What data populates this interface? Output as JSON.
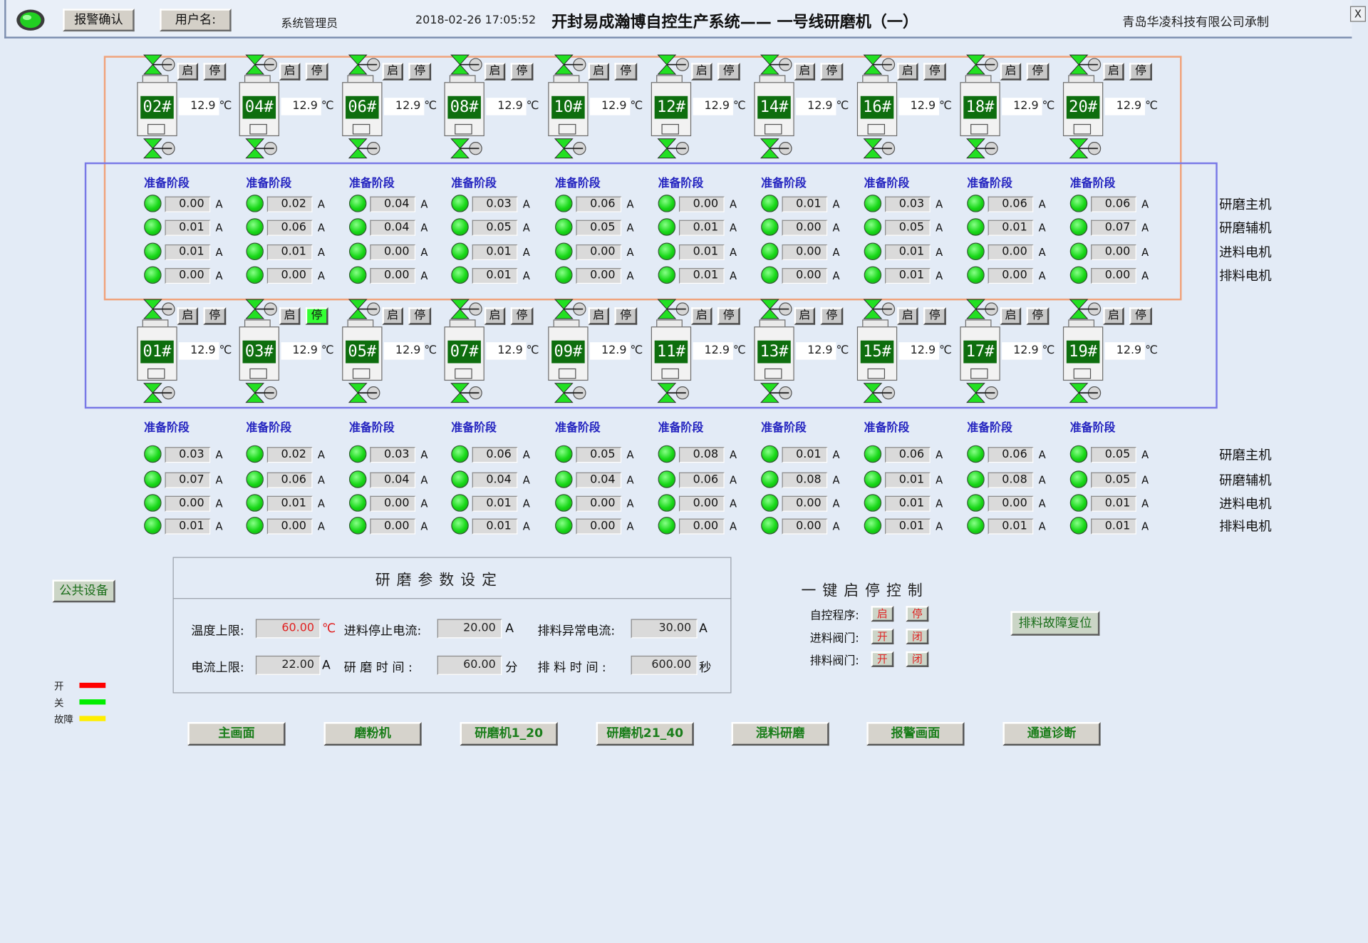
{
  "header": {
    "alarm_ack": "报警确认",
    "user_label": "用户名:",
    "user_name": "系统管理员",
    "datetime": "2018-02-26 17:05:52",
    "title": "开封易成瀚博自控生产系统—— 一号线研磨机（一）",
    "vendor": "青岛华凌科技有限公司承制",
    "close": "X"
  },
  "mill_buttons": {
    "start": "启",
    "stop": "停"
  },
  "temp_unit": "℃",
  "current_unit": "A",
  "stage_text": "准备阶段",
  "row_names": [
    "研磨主机",
    "研磨辅机",
    "进料电机",
    "排料电机"
  ],
  "upper_row": {
    "mills": [
      {
        "id": "02#",
        "temp": "12.9",
        "stop_active": false
      },
      {
        "id": "04#",
        "temp": "12.9",
        "stop_active": false
      },
      {
        "id": "06#",
        "temp": "12.9",
        "stop_active": false
      },
      {
        "id": "08#",
        "temp": "12.9",
        "stop_active": false
      },
      {
        "id": "10#",
        "temp": "12.9",
        "stop_active": false
      },
      {
        "id": "12#",
        "temp": "12.9",
        "stop_active": false
      },
      {
        "id": "14#",
        "temp": "12.9",
        "stop_active": false
      },
      {
        "id": "16#",
        "temp": "12.9",
        "stop_active": false
      },
      {
        "id": "18#",
        "temp": "12.9",
        "stop_active": false
      },
      {
        "id": "20#",
        "temp": "12.9",
        "stop_active": false
      }
    ],
    "currents": [
      [
        "0.00",
        "0.02",
        "0.04",
        "0.03",
        "0.06",
        "0.00",
        "0.01",
        "0.03",
        "0.06",
        "0.06"
      ],
      [
        "0.01",
        "0.06",
        "0.04",
        "0.05",
        "0.05",
        "0.01",
        "0.00",
        "0.05",
        "0.01",
        "0.07"
      ],
      [
        "0.01",
        "0.01",
        "0.00",
        "0.01",
        "0.00",
        "0.01",
        "0.00",
        "0.01",
        "0.00",
        "0.00"
      ],
      [
        "0.00",
        "0.00",
        "0.00",
        "0.01",
        "0.00",
        "0.01",
        "0.00",
        "0.01",
        "0.00",
        "0.00"
      ]
    ]
  },
  "lower_row": {
    "mills": [
      {
        "id": "01#",
        "temp": "12.9",
        "stop_active": false
      },
      {
        "id": "03#",
        "temp": "12.9",
        "stop_active": true
      },
      {
        "id": "05#",
        "temp": "12.9",
        "stop_active": false
      },
      {
        "id": "07#",
        "temp": "12.9",
        "stop_active": false
      },
      {
        "id": "09#",
        "temp": "12.9",
        "stop_active": false
      },
      {
        "id": "11#",
        "temp": "12.9",
        "stop_active": false
      },
      {
        "id": "13#",
        "temp": "12.9",
        "stop_active": false
      },
      {
        "id": "15#",
        "temp": "12.9",
        "stop_active": false
      },
      {
        "id": "17#",
        "temp": "12.9",
        "stop_active": false
      },
      {
        "id": "19#",
        "temp": "12.9",
        "stop_active": false
      }
    ],
    "currents": [
      [
        "0.03",
        "0.02",
        "0.03",
        "0.06",
        "0.05",
        "0.08",
        "0.01",
        "0.06",
        "0.06",
        "0.05"
      ],
      [
        "0.07",
        "0.06",
        "0.04",
        "0.04",
        "0.04",
        "0.06",
        "0.08",
        "0.01",
        "0.08",
        "0.05"
      ],
      [
        "0.00",
        "0.01",
        "0.00",
        "0.01",
        "0.00",
        "0.00",
        "0.00",
        "0.01",
        "0.00",
        "0.01"
      ],
      [
        "0.01",
        "0.00",
        "0.00",
        "0.01",
        "0.00",
        "0.00",
        "0.00",
        "0.01",
        "0.01",
        "0.01"
      ]
    ]
  },
  "public_equipment": "公共设备",
  "params": {
    "title": "研 磨 参 数 设 定",
    "temp_limit_label": "温度上限:",
    "temp_limit_value": "60.00",
    "temp_limit_unit": "℃",
    "feed_stop_current_label": "进料停止电流:",
    "feed_stop_current_value": "20.00",
    "feed_stop_current_unit": "A",
    "discharge_abnormal_label": "排料异常电流:",
    "discharge_abnormal_value": "30.00",
    "discharge_abnormal_unit": "A",
    "current_limit_label": "电流上限:",
    "current_limit_value": "22.00",
    "current_limit_unit": "A",
    "grind_time_label": "研 磨 时 间 :",
    "grind_time_value": "60.00",
    "grind_time_unit": "分",
    "discharge_time_label": "排 料 时 间 :",
    "discharge_time_value": "600.00",
    "discharge_time_unit": "秒"
  },
  "one_key": {
    "title": "一 键 启 停 控 制",
    "auto_label": "自控程序:",
    "auto_start": "启",
    "auto_stop": "停",
    "feed_label": "进料阀门:",
    "feed_open": "开",
    "feed_close": "闭",
    "discharge_label": "排料阀门:",
    "discharge_open": "开",
    "discharge_close": "闭"
  },
  "fault_reset": "排料故障复位",
  "legend": [
    {
      "label": "开",
      "color": "#ff0000"
    },
    {
      "label": "关",
      "color": "#00ee00"
    },
    {
      "label": "故障",
      "color": "#ffee00"
    }
  ],
  "nav": [
    "主画面",
    "磨粉机",
    "研磨机1_20",
    "研磨机21_40",
    "混料研磨",
    "报警画面",
    "通道诊断"
  ],
  "colors": {
    "running_green": "#18d818",
    "label_green": "#0e6e0e",
    "stage_blue": "#2525c0",
    "orange_box": "#f0a27a",
    "blue_box": "#7878e6"
  }
}
